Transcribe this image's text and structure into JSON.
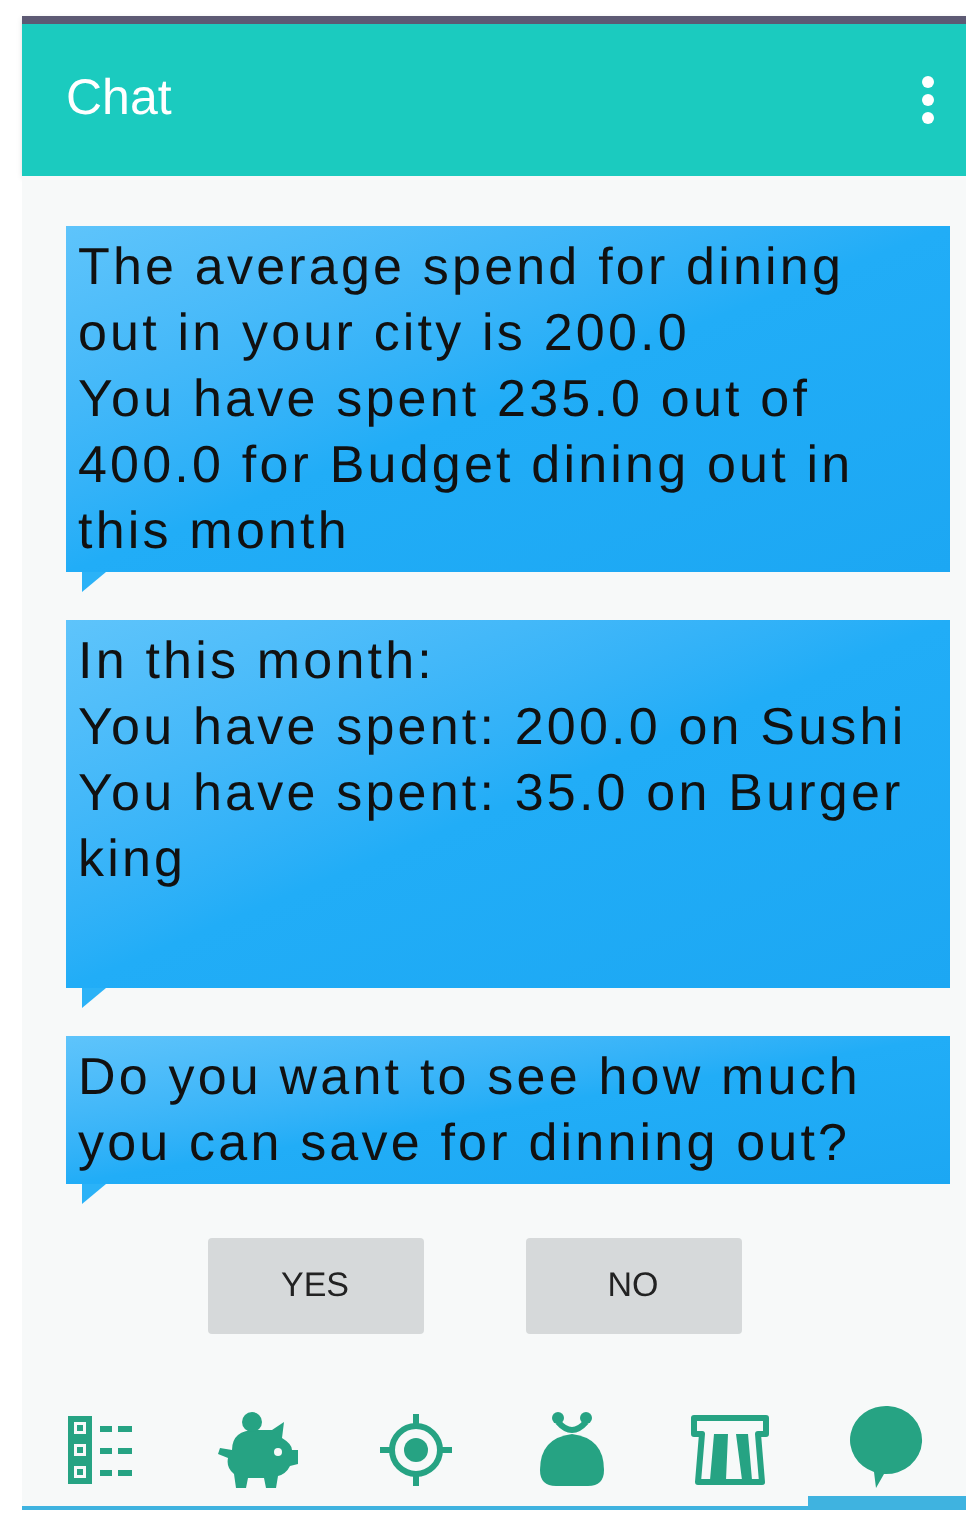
{
  "app_bar": {
    "title": "Chat"
  },
  "messages": [
    {
      "lines": [
        "The average spend for dining out in your city is 200.0",
        "You have spent 235.0 out of 400.0 for Budget dining out in this month"
      ],
      "tall": false
    },
    {
      "lines": [
        "In this month:",
        "You have spent: 200.0 on Sushi",
        "You have spent: 35.0 on Burger king"
      ],
      "tall": true
    },
    {
      "lines": [
        "Do you want to see how much you can save for dinning out?"
      ],
      "tall": false
    }
  ],
  "buttons": [
    "YES",
    "NO"
  ],
  "nav": [
    {
      "kind": "list",
      "selected": false
    },
    {
      "kind": "piggy",
      "selected": false
    },
    {
      "kind": "target",
      "selected": false
    },
    {
      "kind": "purse",
      "selected": false
    },
    {
      "kind": "road",
      "selected": false
    },
    {
      "kind": "chat",
      "selected": true
    }
  ]
}
